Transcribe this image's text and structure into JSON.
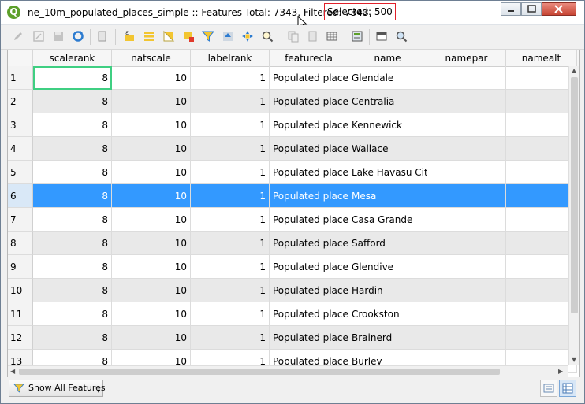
{
  "window": {
    "title": "ne_10m_populated_places_simple :: Features Total: 7343, Filtered: 7343,",
    "selected_label": "Selected: 500",
    "app_icon_letter": "Q"
  },
  "toolbar": {
    "icons": [
      "edit-pencil-icon",
      "multi-edit-icon",
      "save-icon",
      "reload-icon",
      "paste-icon",
      "select-by-expression-icon",
      "select-all-icon",
      "invert-selection-icon",
      "deselect-icon",
      "filter-icon",
      "move-selection-to-top-icon",
      "pan-to-selection-icon",
      "zoom-to-selection-icon",
      "copy-rows-icon",
      "paste-rows-icon",
      "delete-field-icon",
      "field-calculator-icon",
      "conditional-formatting-icon",
      "dock-icon",
      "actions-icon"
    ]
  },
  "table": {
    "columns": [
      "scalerank",
      "natscale",
      "labelrank",
      "featurecla",
      "name",
      "namepar",
      "namealt"
    ],
    "rows": [
      {
        "n": "1",
        "scalerank": "8",
        "natscale": "10",
        "labelrank": "1",
        "featurecla": "Populated place",
        "name": "Glendale"
      },
      {
        "n": "2",
        "scalerank": "8",
        "natscale": "10",
        "labelrank": "1",
        "featurecla": "Populated place",
        "name": "Centralia"
      },
      {
        "n": "3",
        "scalerank": "8",
        "natscale": "10",
        "labelrank": "1",
        "featurecla": "Populated place",
        "name": "Kennewick"
      },
      {
        "n": "4",
        "scalerank": "8",
        "natscale": "10",
        "labelrank": "1",
        "featurecla": "Populated place",
        "name": "Wallace"
      },
      {
        "n": "5",
        "scalerank": "8",
        "natscale": "10",
        "labelrank": "1",
        "featurecla": "Populated place",
        "name": "Lake Havasu City"
      },
      {
        "n": "6",
        "scalerank": "8",
        "natscale": "10",
        "labelrank": "1",
        "featurecla": "Populated place",
        "name": "Mesa"
      },
      {
        "n": "7",
        "scalerank": "8",
        "natscale": "10",
        "labelrank": "1",
        "featurecla": "Populated place",
        "name": "Casa Grande"
      },
      {
        "n": "8",
        "scalerank": "8",
        "natscale": "10",
        "labelrank": "1",
        "featurecla": "Populated place",
        "name": "Safford"
      },
      {
        "n": "9",
        "scalerank": "8",
        "natscale": "10",
        "labelrank": "1",
        "featurecla": "Populated place",
        "name": "Glendive"
      },
      {
        "n": "10",
        "scalerank": "8",
        "natscale": "10",
        "labelrank": "1",
        "featurecla": "Populated place",
        "name": "Hardin"
      },
      {
        "n": "11",
        "scalerank": "8",
        "natscale": "10",
        "labelrank": "1",
        "featurecla": "Populated place",
        "name": "Crookston"
      },
      {
        "n": "12",
        "scalerank": "8",
        "natscale": "10",
        "labelrank": "1",
        "featurecla": "Populated place",
        "name": "Brainerd"
      },
      {
        "n": "13",
        "scalerank": "8",
        "natscale": "10",
        "labelrank": "1",
        "featurecla": "Populated place",
        "name": "Burley"
      }
    ],
    "selected_row_index": 5,
    "current_cell": {
      "row": 0,
      "column": "scalerank"
    }
  },
  "footer": {
    "show_features_label": "Show All Features",
    "view_buttons": [
      "form-view-icon",
      "table-view-icon"
    ]
  },
  "colors": {
    "selection": "#3399ff",
    "selected_highlight_border": "#e0202a",
    "current_cell_outline": "#3fcf82",
    "app_icon": "#5da02a"
  }
}
